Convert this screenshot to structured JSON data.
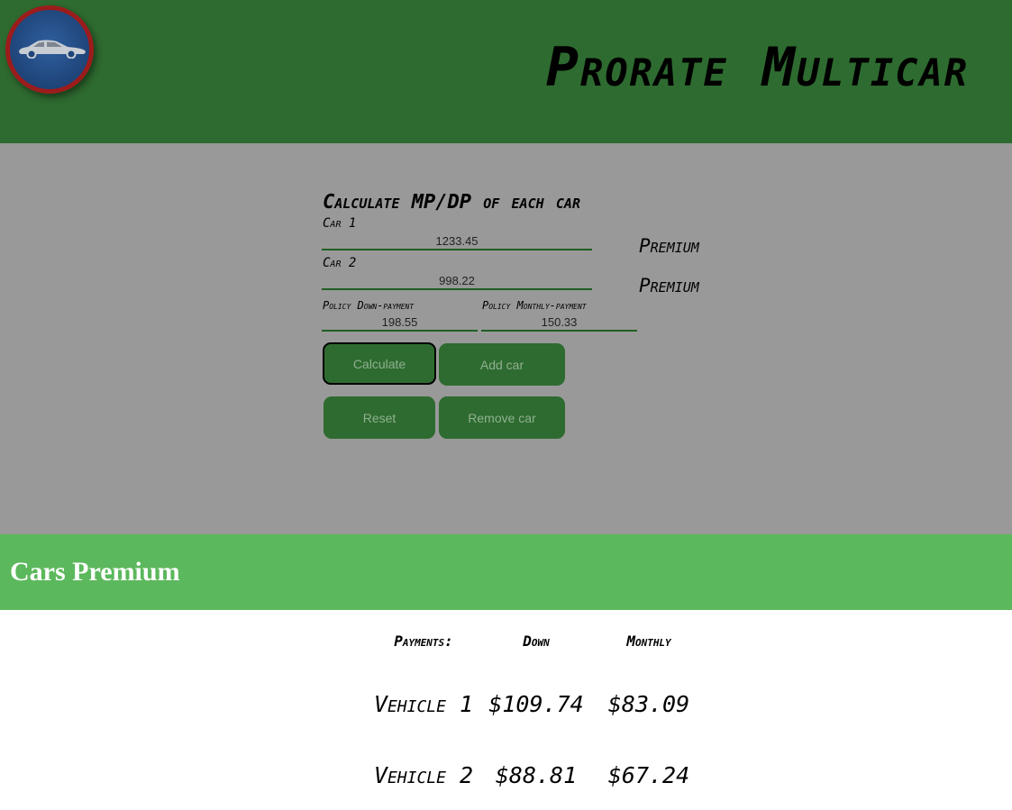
{
  "header": {
    "title": "Prorate Multicar",
    "logo_icon": "car-icon"
  },
  "form": {
    "title": "Calculate MP/DP of each car",
    "cars": [
      {
        "label": "Car 1",
        "value": "1233.45",
        "premium_label": "Premium"
      },
      {
        "label": "Car 2",
        "value": "998.22",
        "premium_label": "Premium"
      }
    ],
    "down_payment": {
      "label": "Policy Down-payment",
      "value": "198.55"
    },
    "monthly_payment": {
      "label": "Policy Monthly-payment",
      "value": "150.33"
    },
    "buttons": {
      "calculate": "Calculate",
      "add_car": "Add car",
      "reset": "Reset",
      "remove_car": "Remove car"
    }
  },
  "results": {
    "title": "Cars Premium",
    "headers": [
      "Payments:",
      "Down",
      "Monthly"
    ],
    "rows": [
      {
        "vehicle": "Vehicle 1",
        "down": "$109.74",
        "monthly": "$83.09"
      },
      {
        "vehicle": "Vehicle 2",
        "down": "$88.81",
        "monthly": "$67.24"
      }
    ]
  },
  "colors": {
    "header_green": "#2e6b30",
    "band_green": "#5cb85c",
    "panel_gray": "#999999",
    "logo_ring": "#9c1c1c",
    "logo_blue": "#1f4478"
  }
}
